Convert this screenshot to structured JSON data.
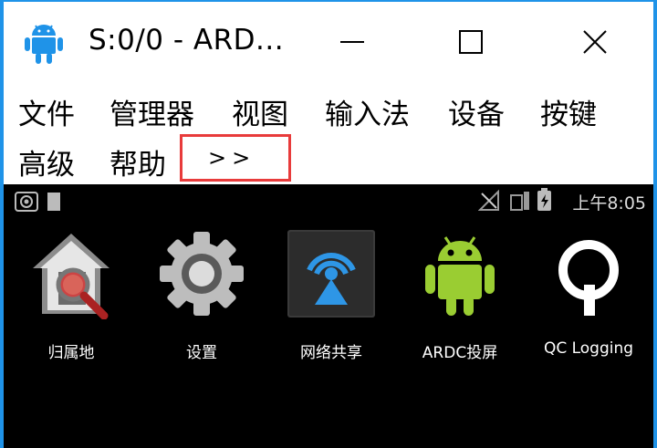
{
  "window": {
    "title": "S:0/0 - ARD...",
    "colors": {
      "border": "#1f93e8",
      "highlight": "#e83b3b",
      "android_green": "#9acd32"
    }
  },
  "menu": {
    "items": [
      "文件",
      "管理器",
      "视图",
      "输入法",
      "设备",
      "按键",
      "高级",
      "帮助"
    ],
    "more_label": ">>"
  },
  "device": {
    "status": {
      "time": "上午8:05"
    },
    "apps": [
      {
        "label": "归属地",
        "icon": "house-magnifier-icon"
      },
      {
        "label": "设置",
        "icon": "gear-icon"
      },
      {
        "label": "网络共享",
        "icon": "wifi-tether-icon"
      },
      {
        "label": "ARDC投屏",
        "icon": "android-icon"
      },
      {
        "label": "QC Logging",
        "icon": "qc-logo-icon"
      }
    ]
  }
}
